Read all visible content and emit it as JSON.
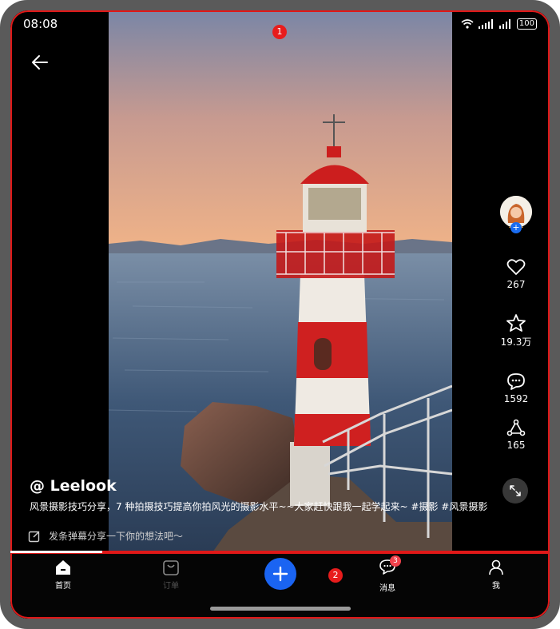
{
  "status": {
    "time": "08:08",
    "battery": "100"
  },
  "badges": {
    "one": "1",
    "two": "2"
  },
  "post": {
    "author": "@ Leelook",
    "description": "风景摄影技巧分享，7 种拍摄技巧提高你拍风光的摄影水平~~大家赶快跟我一起学起来~ #摄影 #风景摄影",
    "danmu_placeholder": "发条弹幕分享一下你的想法吧～"
  },
  "actions": {
    "likes": "267",
    "favorites": "19.3万",
    "comments": "1592",
    "shares": "165"
  },
  "nav": {
    "home": "首页",
    "shop": "订单",
    "messages": "消息",
    "messages_badge": "3",
    "me": "我"
  },
  "icons": [
    "back-arrow-icon",
    "wifi-icon",
    "signal-icon",
    "battery-icon",
    "heart-icon",
    "star-icon",
    "comment-icon",
    "share-icon",
    "expand-icon",
    "edit-icon",
    "home-icon",
    "bag-icon",
    "plus-icon",
    "message-icon",
    "person-icon"
  ],
  "colors": {
    "accent": "#1a64f2",
    "badge": "#e81c1c",
    "highlight_frame": "#e01818"
  }
}
